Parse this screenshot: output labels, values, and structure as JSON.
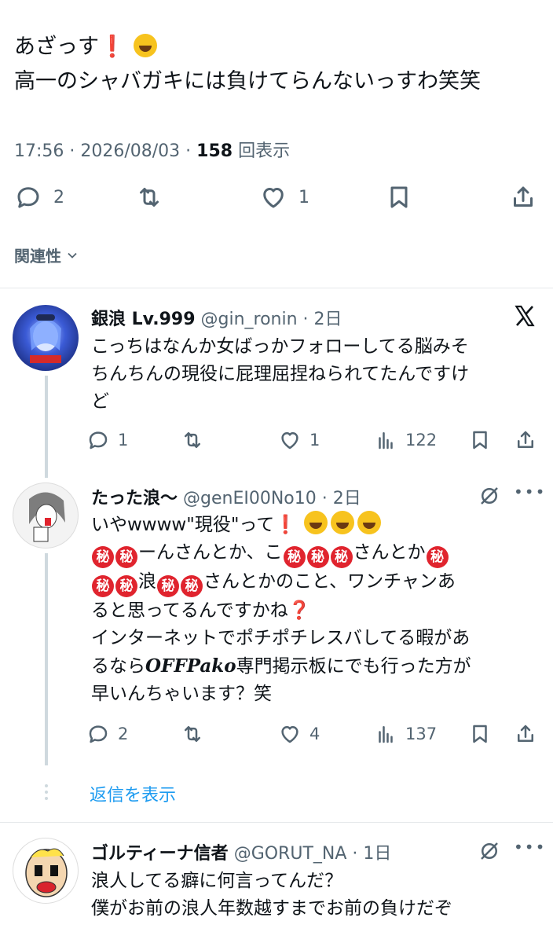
{
  "tweet": {
    "line1": "あざっす❗️",
    "line2": "高一のシャバガキには負けてらんないっすわ笑笑",
    "time": "17:56 · 2026/08/03 · ",
    "views": "158",
    "views_label": "回表示",
    "replies": "2",
    "likes": "1"
  },
  "related_label": "関連性",
  "replies": [
    {
      "name": "銀浪 Lv.999",
      "handle": "@gin_ronin · 2日",
      "lines": [
        "こっちはなんか女ばっかフォローしてる脳みそ",
        "ちんちんの現役に屁理屈捏ねられてたんですけ",
        "ど"
      ],
      "replies": "1",
      "likes": "1",
      "views": "122"
    },
    {
      "name": "たった浪〜",
      "handle": "@genEI00No10 · 2日",
      "line1_prefix": "いやwwww\"現役\"って",
      "line2_a": "ーんさんとか、こ",
      "line2_b": "さんとか",
      "line3_a": "浪",
      "line3_b": "さんとかのこと、ワンチャンあ",
      "line4": "ると思ってるんですかね",
      "line5": "インターネットでポチポチレスバしてる暇があ",
      "line6_a": "るなら",
      "line6_styled": "OFFPako",
      "line6_b": "専門掲示板にでも行った方が",
      "line7": "早いんちゃいます？笑",
      "secret_glyph": "秘",
      "replies": "2",
      "likes": "4",
      "views": "137"
    },
    {
      "name": "ゴルティーナ信者",
      "handle": "@GORUT_NA · 1日",
      "lines": [
        "浪人してる癖に何言ってんだ？",
        "僕がお前の浪人年数越すまでお前の負けだぞ"
      ]
    }
  ],
  "show_replies": "返信を表示"
}
